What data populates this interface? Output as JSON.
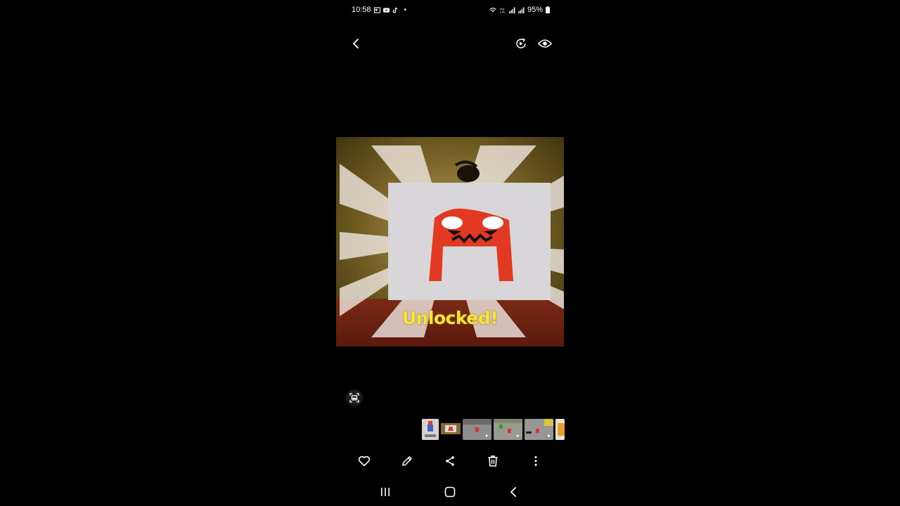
{
  "status_bar": {
    "time": "10:58",
    "battery": "95%",
    "left_icons": [
      "gallery-notification-icon",
      "youtube-icon",
      "tiktok-icon",
      "dot-icon"
    ],
    "right_icons": [
      "wifi-icon",
      "volte-icon",
      "signal-icon",
      "signal-icon-2",
      "battery-icon"
    ]
  },
  "photo": {
    "caption": "Unlocked!",
    "colors": {
      "background": "#6f5a2a",
      "card": "#d8d6d8",
      "letter": "#e23a22",
      "caption": "#f5e43a"
    }
  },
  "filmstrip": {
    "thumbnail_count": 6
  },
  "actions": [
    "favorite-icon",
    "edit-icon",
    "share-icon",
    "delete-icon",
    "more-icon"
  ],
  "nav": [
    "recent-apps-icon",
    "home-icon",
    "back-icon"
  ]
}
